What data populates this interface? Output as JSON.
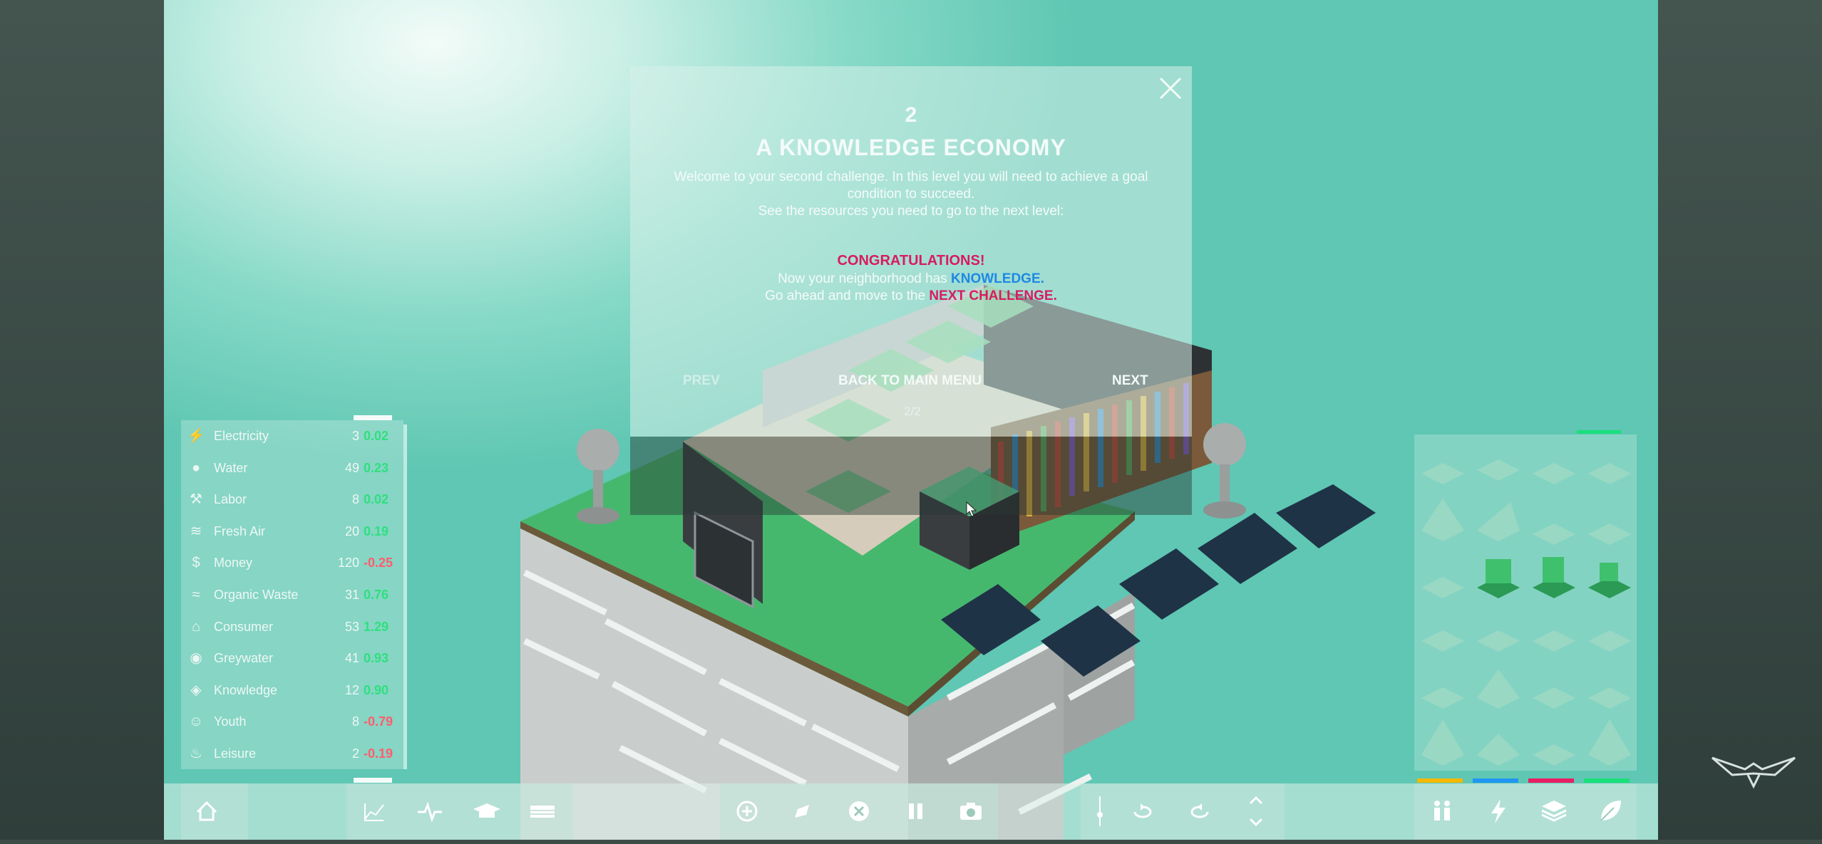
{
  "dialog": {
    "level_number": "2",
    "title": "A KNOWLEDGE ECONOMY",
    "description": "Welcome to your second challenge. In this level you will need to achieve a goal condition to succeed.",
    "description2": "See the resources you need to go to the next level:",
    "congrats": "CONGRATULATIONS!",
    "line1_prefix": "Now your neighborhood has ",
    "line1_keyword": "KNOWLEDGE.",
    "line2_prefix": "Go ahead and move to the ",
    "line2_keyword": "NEXT CHALLENGE.",
    "prev_label": "PREV",
    "menu_label": "BACK TO MAIN MENU",
    "next_label": "NEXT",
    "page_indicator": "2/2",
    "close_icon": "close-icon"
  },
  "resources": [
    {
      "name": "Electricity",
      "value": "3",
      "rate": "0.02",
      "positive": true,
      "icon": "bolt-icon"
    },
    {
      "name": "Water",
      "value": "49",
      "rate": "0.23",
      "positive": true,
      "icon": "water-drop-icon"
    },
    {
      "name": "Labor",
      "value": "8",
      "rate": "0.02",
      "positive": true,
      "icon": "worker-icon"
    },
    {
      "name": "Fresh Air",
      "value": "20",
      "rate": "0.19",
      "positive": true,
      "icon": "wind-icon"
    },
    {
      "name": "Money",
      "value": "120",
      "rate": "-0.25",
      "positive": false,
      "icon": "dollar-icon"
    },
    {
      "name": "Organic Waste",
      "value": "31",
      "rate": "0.76",
      "positive": true,
      "icon": "compost-icon"
    },
    {
      "name": "Consumer",
      "value": "53",
      "rate": "1.29",
      "positive": true,
      "icon": "consumer-icon"
    },
    {
      "name": "Greywater",
      "value": "41",
      "rate": "0.93",
      "positive": true,
      "icon": "greywater-icon"
    },
    {
      "name": "Knowledge",
      "value": "12",
      "rate": "0.90",
      "positive": true,
      "icon": "graduation-cap-icon"
    },
    {
      "name": "Youth",
      "value": "8",
      "rate": "-0.79",
      "positive": false,
      "icon": "youth-icon"
    },
    {
      "name": "Leisure",
      "value": "2",
      "rate": "-0.19",
      "positive": false,
      "icon": "leisure-icon"
    }
  ],
  "colors": {
    "positive_rate": "#2fe07e",
    "negative_rate": "#ff5d6c",
    "accent_green": "#19e07a",
    "congrats_pink": "#d81b60",
    "knowledge_blue": "#1e88e5"
  },
  "toolbar": {
    "left": [
      "home-icon"
    ],
    "stats": [
      "chart-icon",
      "pulse-icon",
      "graduation-cap-icon",
      "keyboard-icon"
    ],
    "actions": [
      "add-circle-icon",
      "edit-icon",
      "remove-circle-icon",
      "pause-icon",
      "camera-icon"
    ],
    "camera": [
      "zoom-slider-icon",
      "rotate-left-icon",
      "rotate-right-icon",
      "chevron-up-icon",
      "chevron-down-icon"
    ],
    "categories": [
      "people-icon",
      "bolt-icon",
      "layers-icon",
      "leaf-icon"
    ],
    "category_colors": [
      "#f5b800",
      "#2196f3",
      "#e91e63",
      "#19e07a"
    ]
  }
}
